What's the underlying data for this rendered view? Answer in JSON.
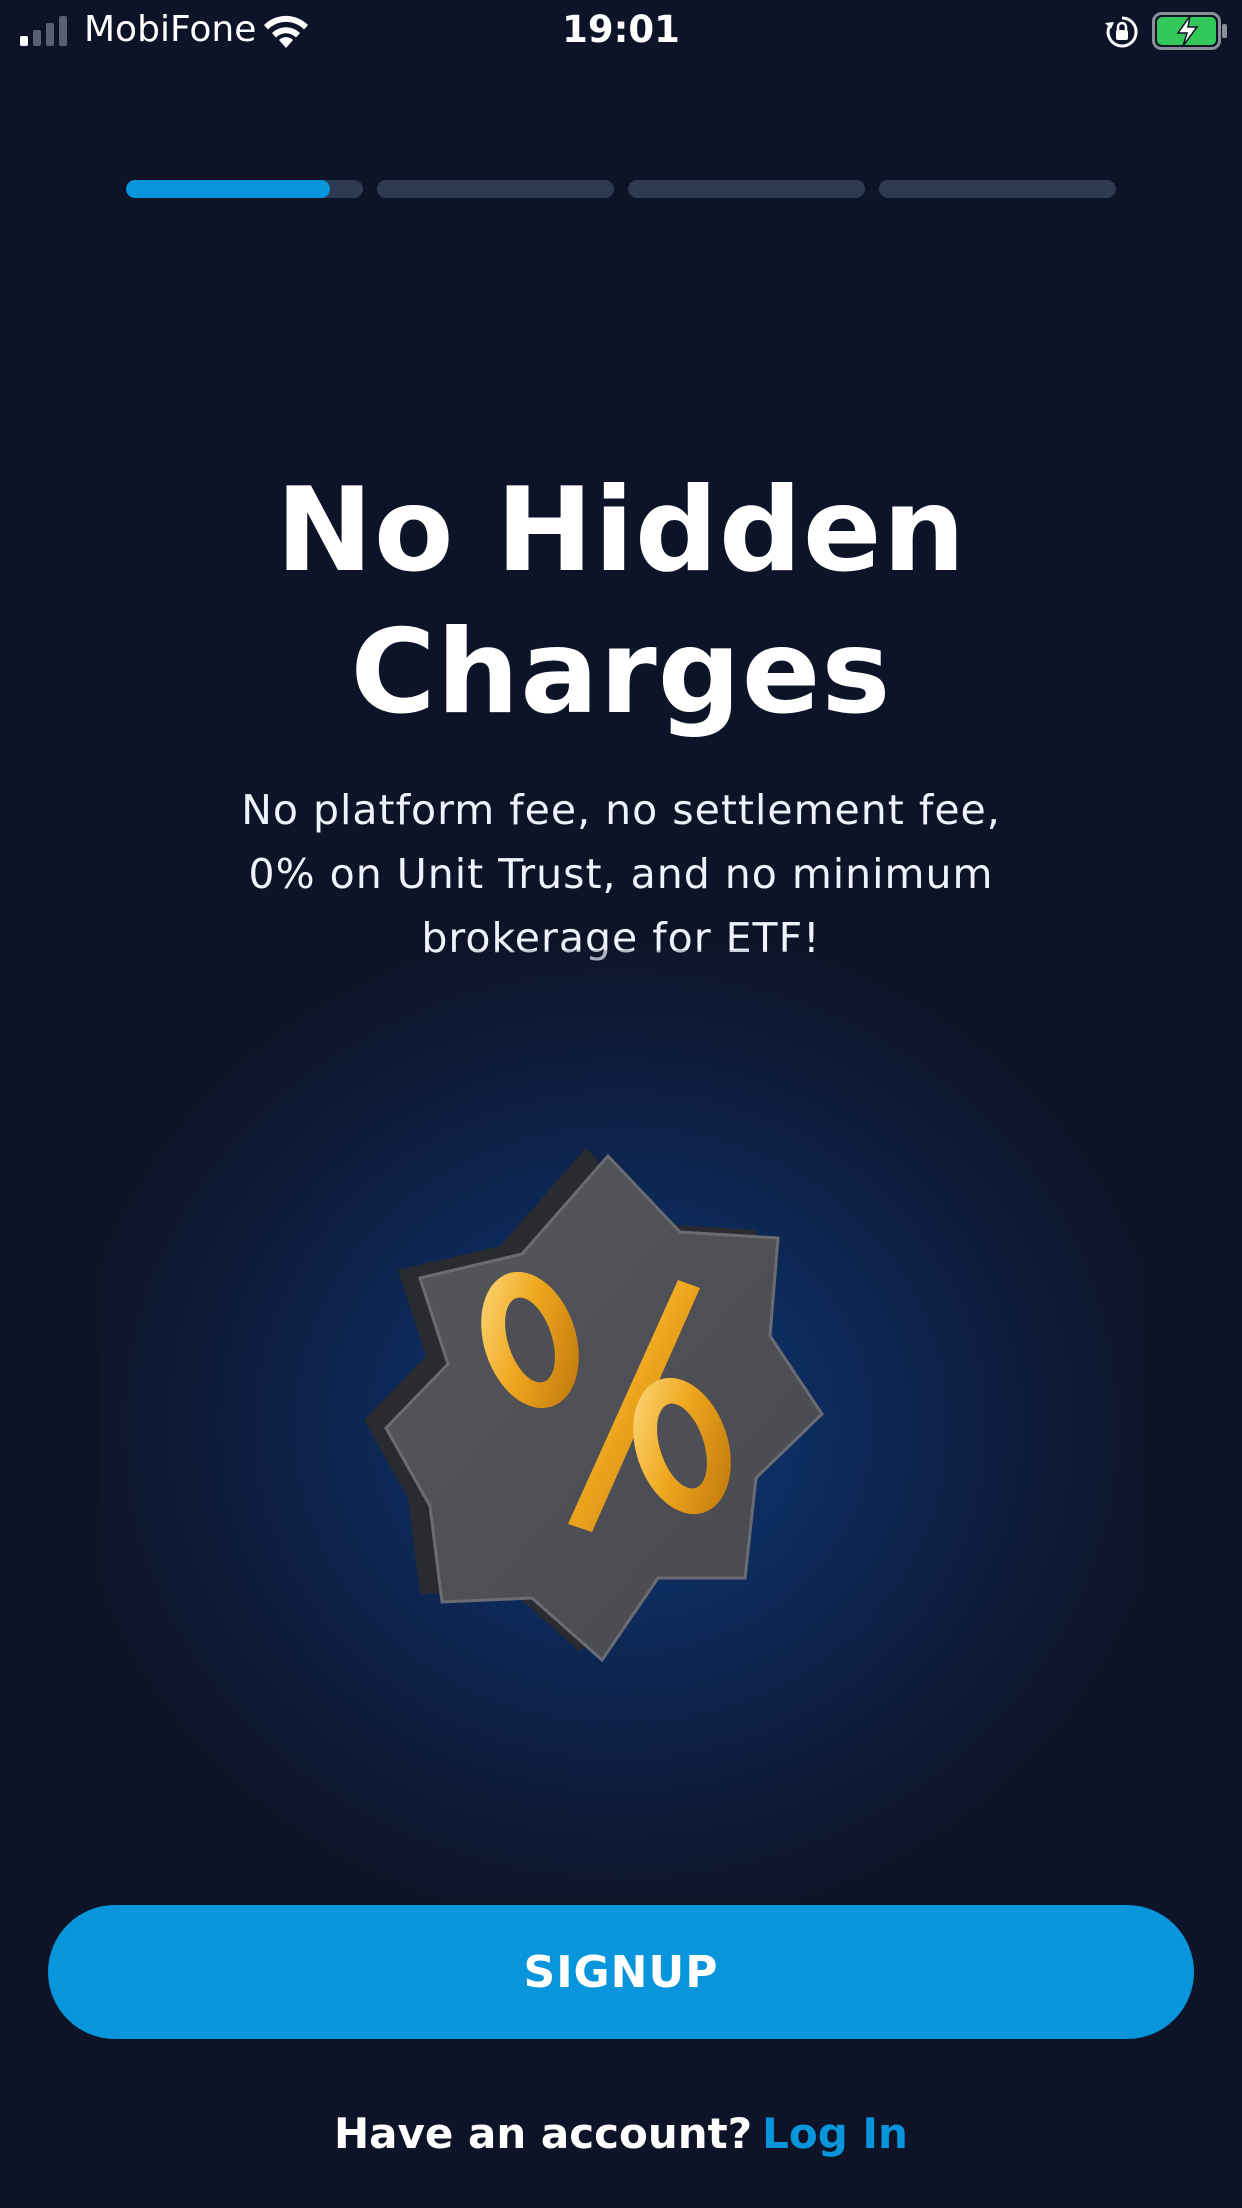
{
  "status_bar": {
    "carrier": "MobiFone",
    "time": "19:01",
    "icons": [
      "signal-icon",
      "wifi-icon",
      "orientation-lock-icon",
      "battery-charging-icon"
    ]
  },
  "progress": {
    "total_steps": 4,
    "current_step": 1,
    "current_step_fill": 0.86
  },
  "onboarding": {
    "title_line1": "No Hidden",
    "title_line2": "Charges",
    "subtitle_line1": "No platform fee, no settlement fee,",
    "subtitle_line2": "0% on Unit Trust, and no minimum",
    "subtitle_line3": "brokerage for ETF!",
    "illustration": "percent-badge-icon"
  },
  "actions": {
    "signup_label": "SIGNUP",
    "have_account_text": "Have an account?",
    "login_label": "Log In"
  },
  "colors": {
    "background": "#0e1428",
    "accent": "#0995dc",
    "progress_track": "#2e3a52",
    "battery": "#34c759"
  }
}
